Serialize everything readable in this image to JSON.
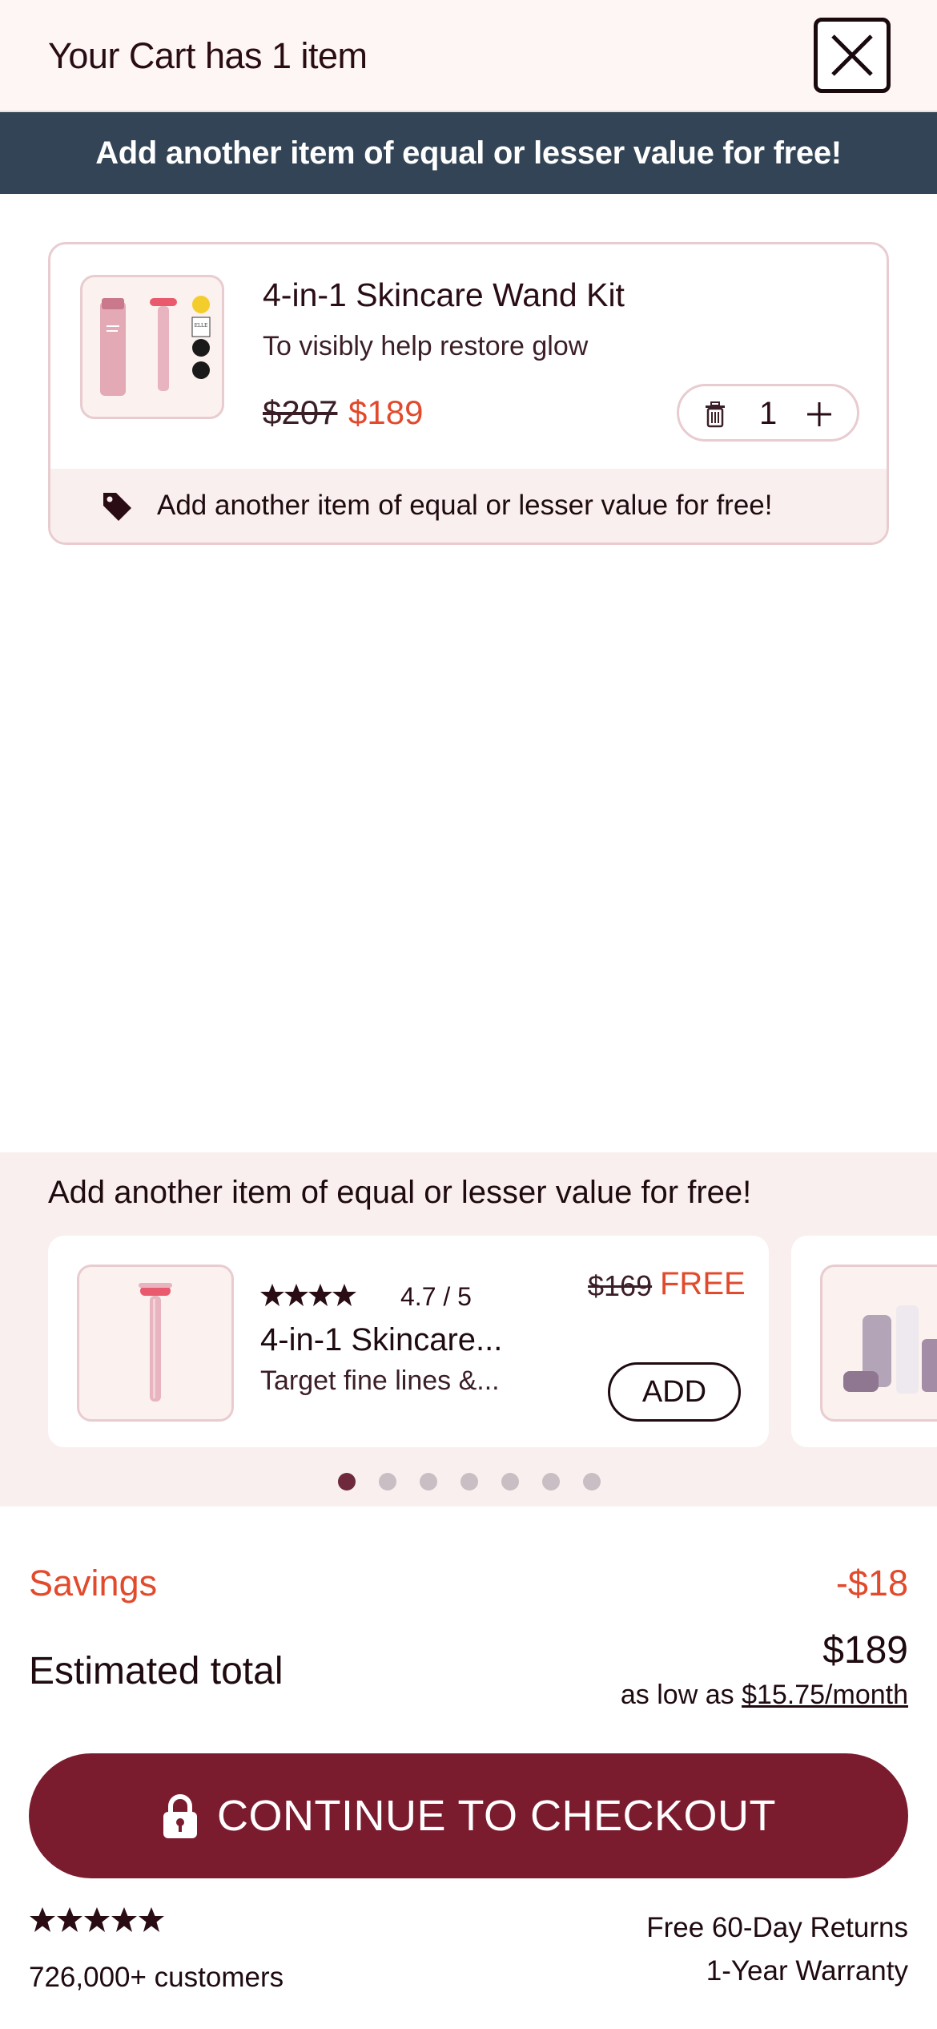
{
  "header": {
    "title": "Your Cart has 1 item",
    "close_icon": "close-icon"
  },
  "banner": {
    "text": "Add another item of equal or lesser value for free!",
    "background": "#324455"
  },
  "cart_item": {
    "title": "4-in-1 Skincare Wand Kit",
    "subtitle": "To visibly help restore glow",
    "price_original": "$207",
    "price_sale": "$189",
    "quantity": "1",
    "promo_message": "Add another item of equal or lesser value for free!",
    "icons": [
      "trash-icon",
      "plus-icon",
      "tag-icon"
    ]
  },
  "upsell": {
    "title": "Add another item of equal or lesser value for free!",
    "items": [
      {
        "rating": "4.7 / 5",
        "stars": 4.7,
        "name": "4-in-1 Skincare...",
        "subtitle": "Target fine lines &...",
        "price_original": "$169",
        "price_label": "FREE",
        "add_label": "ADD"
      }
    ],
    "carousel": {
      "pages": 7,
      "active_index": 0
    }
  },
  "summary": {
    "savings_label": "Savings",
    "savings_value": "-$18",
    "total_label": "Estimated total",
    "total_value": "$189",
    "financing_prefix": "as low as ",
    "financing_link": "$15.75/month"
  },
  "checkout": {
    "label": "CONTINUE TO CHECKOUT",
    "icon": "lock-icon",
    "color": "#7b1c2e"
  },
  "footer": {
    "stars": 5,
    "customers": "726,000+ customers",
    "returns": "Free 60-Day Returns",
    "warranty": "1-Year Warranty"
  },
  "colors": {
    "accent_red": "#e24a2c",
    "text_dark": "#1e0a0f",
    "card_border": "#e8ccd0",
    "tint_bg": "#f8efee"
  }
}
